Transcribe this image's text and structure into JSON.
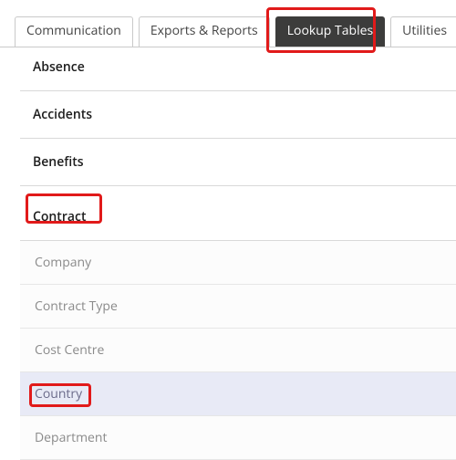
{
  "tabs": {
    "communication": "Communication",
    "exports": "Exports & Reports",
    "lookup": "Lookup Tables",
    "utilities": "Utilities"
  },
  "sections": {
    "absence": "Absence",
    "accidents": "Accidents",
    "benefits": "Benefits",
    "contract": "Contract"
  },
  "contract_items": {
    "company": "Company",
    "contract_type": "Contract Type",
    "cost_centre": "Cost Centre",
    "country": "Country",
    "department": "Department"
  }
}
